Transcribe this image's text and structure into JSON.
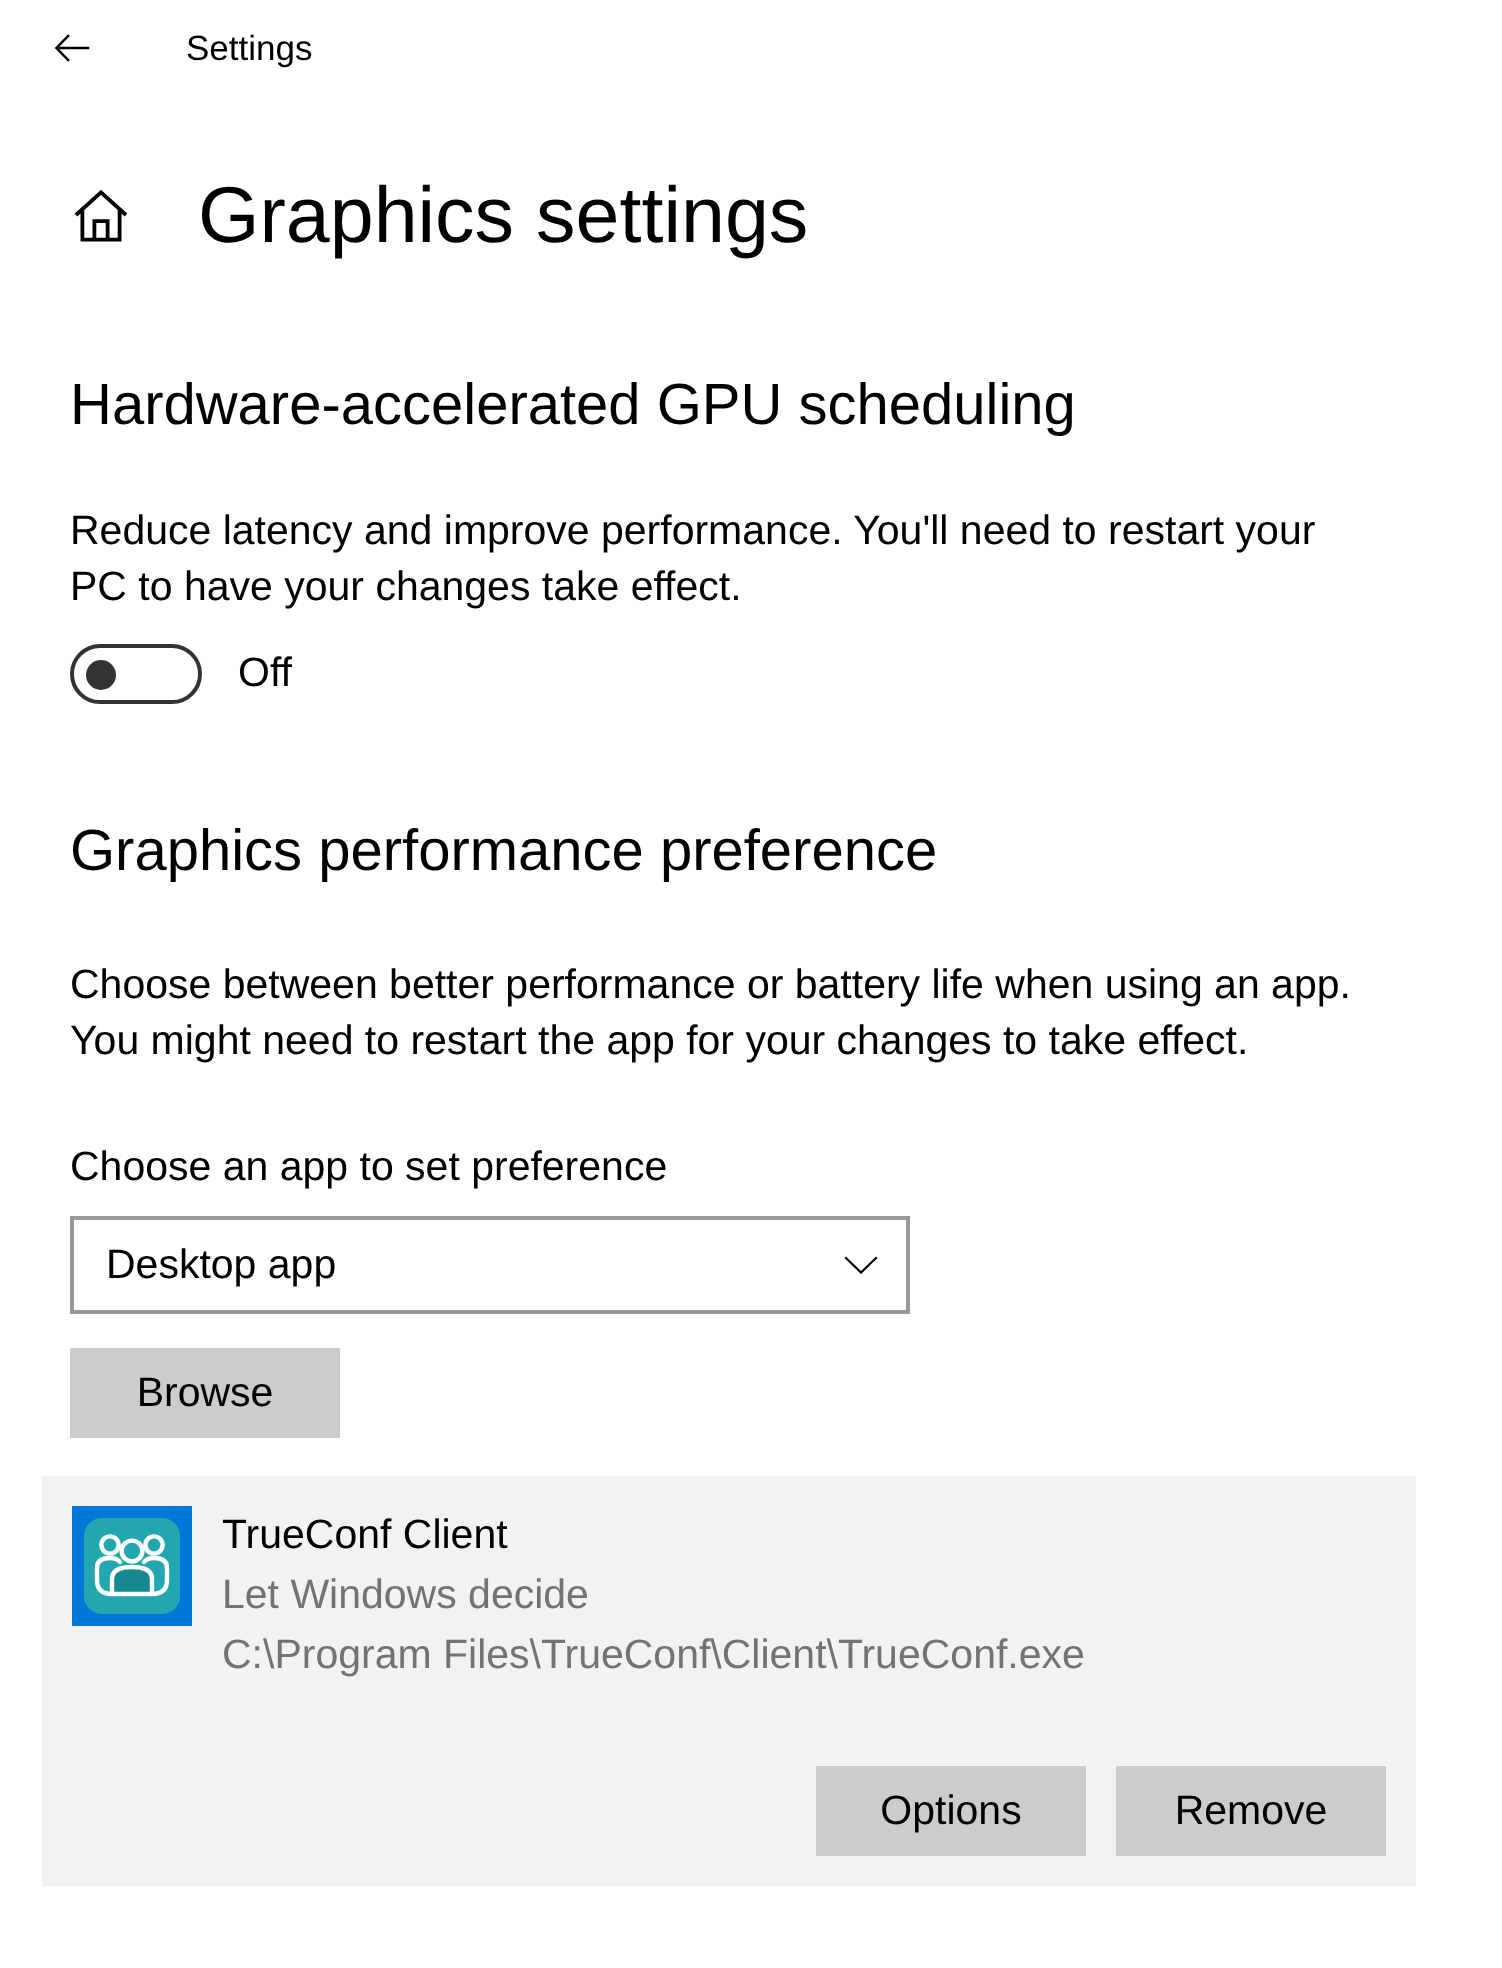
{
  "header": {
    "title": "Settings"
  },
  "page": {
    "title": "Graphics settings"
  },
  "sections": [
    {
      "kind": "toggle",
      "heading": "Hardware-accelerated GPU scheduling",
      "description": "Reduce latency and improve performance. You'll need to restart your PC to have your changes take effect.",
      "toggle": {
        "on": false,
        "state_label": "Off"
      }
    },
    {
      "kind": "app_preference",
      "heading": "Graphics performance preference",
      "description": "Choose between better performance or battery life when using an app. You might need to restart the app for your changes to take effect.",
      "picker_label": "Choose an app to set preference",
      "dropdown": {
        "value": "Desktop app"
      },
      "browse_button": "Browse",
      "apps": [
        {
          "name": "TrueConf Client",
          "preference": "Let Windows decide",
          "path": "C:\\Program Files\\TrueConf\\Client\\TrueConf.exe",
          "selected": true,
          "buttons": [
            "Options",
            "Remove"
          ]
        }
      ]
    }
  ]
}
